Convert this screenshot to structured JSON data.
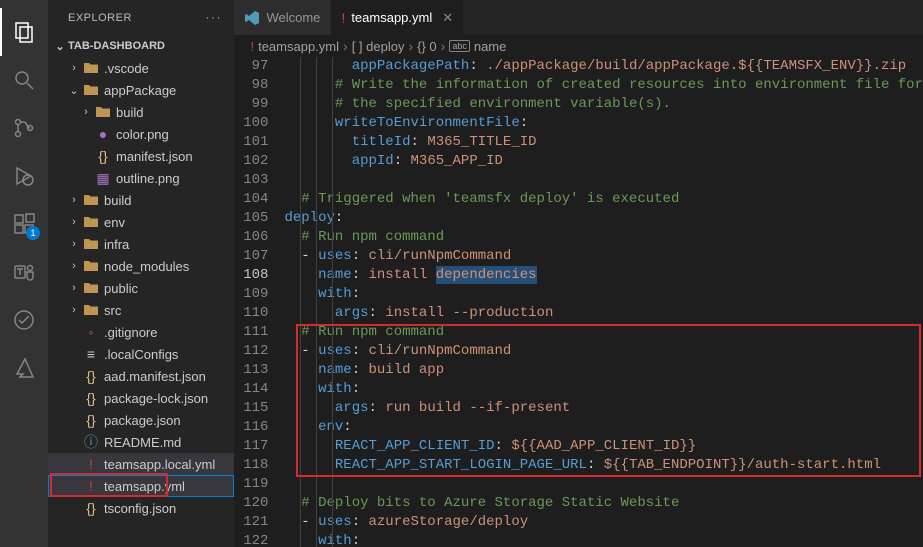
{
  "sidebarTitle": "EXPLORER",
  "sectionTitle": "TAB-DASHBOARD",
  "tree": [
    {
      "indent": 1,
      "chev": "right",
      "iconColor": "",
      "name": ".vscode",
      "folder": true
    },
    {
      "indent": 1,
      "chev": "down",
      "iconColor": "",
      "name": "appPackage",
      "folder": true
    },
    {
      "indent": 2,
      "chev": "right",
      "iconColor": "",
      "name": "build",
      "folder": true
    },
    {
      "indent": 2,
      "chev": "none",
      "iconColor": "ico-purple",
      "icon": "●",
      "name": "color.png"
    },
    {
      "indent": 2,
      "chev": "none",
      "iconColor": "ico-yellow",
      "icon": "{}",
      "name": "manifest.json"
    },
    {
      "indent": 2,
      "chev": "none",
      "iconColor": "ico-purple",
      "icon": "▦",
      "name": "outline.png"
    },
    {
      "indent": 1,
      "chev": "right",
      "iconColor": "",
      "name": "build",
      "folder": true
    },
    {
      "indent": 1,
      "chev": "right",
      "iconColor": "",
      "name": "env",
      "folder": true
    },
    {
      "indent": 1,
      "chev": "right",
      "iconColor": "",
      "name": "infra",
      "folder": true
    },
    {
      "indent": 1,
      "chev": "right",
      "iconColor": "",
      "name": "node_modules",
      "folder": true
    },
    {
      "indent": 1,
      "chev": "right",
      "iconColor": "",
      "name": "public",
      "folder": true
    },
    {
      "indent": 1,
      "chev": "right",
      "iconColor": "",
      "name": "src",
      "folder": true
    },
    {
      "indent": 1,
      "chev": "none",
      "iconColor": "ico-orange",
      "icon": "◦",
      "name": ".gitignore"
    },
    {
      "indent": 1,
      "chev": "none",
      "iconColor": "",
      "icon": "≡",
      "name": ".localConfigs"
    },
    {
      "indent": 1,
      "chev": "none",
      "iconColor": "ico-yellow",
      "icon": "{}",
      "name": "aad.manifest.json"
    },
    {
      "indent": 1,
      "chev": "none",
      "iconColor": "ico-yellow",
      "icon": "{}",
      "name": "package-lock.json"
    },
    {
      "indent": 1,
      "chev": "none",
      "iconColor": "ico-yellow",
      "icon": "{}",
      "name": "package.json"
    },
    {
      "indent": 1,
      "chev": "none",
      "iconColor": "ico-blue",
      "icon": "ⓘ",
      "name": "README.md"
    },
    {
      "indent": 1,
      "chev": "none",
      "iconColor": "ico-red",
      "icon": "!",
      "name": "teamsapp.local.yml",
      "highlighted": true
    },
    {
      "indent": 1,
      "chev": "none",
      "iconColor": "ico-red",
      "icon": "!",
      "name": "teamsapp.yml",
      "selected": true
    },
    {
      "indent": 1,
      "chev": "none",
      "iconColor": "ico-yellow",
      "icon": "{}",
      "name": "tsconfig.json"
    }
  ],
  "tabs": [
    {
      "icon": "vs",
      "label": "Welcome",
      "active": false
    },
    {
      "icon": "!",
      "iconColor": "ico-red",
      "label": "teamsapp.yml",
      "active": true,
      "close": true
    }
  ],
  "breadcrumb": {
    "file": "teamsapp.yml",
    "seg1": "[ ] deploy",
    "seg2": "{} 0",
    "seg3": "name",
    "seg3icon": "abc"
  },
  "code": {
    "startLine": 97,
    "currentLine": 108,
    "lines": [
      [
        {
          "t": "        ",
          "c": ""
        },
        {
          "t": "appPackagePath",
          "c": "c-key"
        },
        {
          "t": ": ",
          "c": ""
        },
        {
          "t": "./appPackage/build/appPackage.${{TEAMSFX_ENV}}.zip",
          "c": "c-str"
        }
      ],
      [
        {
          "t": "      ",
          "c": ""
        },
        {
          "t": "# Write the information of created resources into environment file for",
          "c": "c-comment"
        }
      ],
      [
        {
          "t": "      ",
          "c": ""
        },
        {
          "t": "# the specified environment variable(s).",
          "c": "c-comment"
        }
      ],
      [
        {
          "t": "      ",
          "c": ""
        },
        {
          "t": "writeToEnvironmentFile",
          "c": "c-key"
        },
        {
          "t": ":",
          "c": ""
        }
      ],
      [
        {
          "t": "        ",
          "c": ""
        },
        {
          "t": "titleId",
          "c": "c-key"
        },
        {
          "t": ": ",
          "c": ""
        },
        {
          "t": "M365_TITLE_ID",
          "c": "c-str"
        }
      ],
      [
        {
          "t": "        ",
          "c": ""
        },
        {
          "t": "appId",
          "c": "c-key"
        },
        {
          "t": ": ",
          "c": ""
        },
        {
          "t": "M365_APP_ID",
          "c": "c-str"
        }
      ],
      [],
      [
        {
          "t": "  ",
          "c": ""
        },
        {
          "t": "# Triggered when 'teamsfx deploy' is executed",
          "c": "c-comment"
        }
      ],
      [
        {
          "t": "",
          "c": ""
        },
        {
          "t": "deploy",
          "c": "c-key"
        },
        {
          "t": ":",
          "c": ""
        }
      ],
      [
        {
          "t": "  ",
          "c": ""
        },
        {
          "t": "# Run npm command",
          "c": "c-comment"
        }
      ],
      [
        {
          "t": "  - ",
          "c": ""
        },
        {
          "t": "uses",
          "c": "c-key"
        },
        {
          "t": ": ",
          "c": ""
        },
        {
          "t": "cli/runNpmCommand",
          "c": "c-str"
        }
      ],
      [
        {
          "t": "    ",
          "c": ""
        },
        {
          "t": "name",
          "c": "c-key"
        },
        {
          "t": ": ",
          "c": ""
        },
        {
          "t": "install ",
          "c": "c-str"
        },
        {
          "t": "dependencies",
          "c": "c-str",
          "sel": true
        }
      ],
      [
        {
          "t": "    ",
          "c": ""
        },
        {
          "t": "with",
          "c": "c-key"
        },
        {
          "t": ":",
          "c": ""
        }
      ],
      [
        {
          "t": "      ",
          "c": ""
        },
        {
          "t": "args",
          "c": "c-key"
        },
        {
          "t": ": ",
          "c": ""
        },
        {
          "t": "install --production",
          "c": "c-str"
        }
      ],
      [
        {
          "t": "  ",
          "c": ""
        },
        {
          "t": "# Run npm command",
          "c": "c-comment"
        }
      ],
      [
        {
          "t": "  - ",
          "c": ""
        },
        {
          "t": "uses",
          "c": "c-key"
        },
        {
          "t": ": ",
          "c": ""
        },
        {
          "t": "cli/runNpmCommand",
          "c": "c-str"
        }
      ],
      [
        {
          "t": "    ",
          "c": ""
        },
        {
          "t": "name",
          "c": "c-key"
        },
        {
          "t": ": ",
          "c": ""
        },
        {
          "t": "build app",
          "c": "c-str"
        }
      ],
      [
        {
          "t": "    ",
          "c": ""
        },
        {
          "t": "with",
          "c": "c-key"
        },
        {
          "t": ":",
          "c": ""
        }
      ],
      [
        {
          "t": "      ",
          "c": ""
        },
        {
          "t": "args",
          "c": "c-key"
        },
        {
          "t": ": ",
          "c": ""
        },
        {
          "t": "run build --if-present",
          "c": "c-str"
        }
      ],
      [
        {
          "t": "    ",
          "c": ""
        },
        {
          "t": "env",
          "c": "c-key"
        },
        {
          "t": ":",
          "c": ""
        }
      ],
      [
        {
          "t": "      ",
          "c": ""
        },
        {
          "t": "REACT_APP_CLIENT_ID",
          "c": "c-key"
        },
        {
          "t": ": ",
          "c": ""
        },
        {
          "t": "${{AAD_APP_CLIENT_ID}}",
          "c": "c-str"
        }
      ],
      [
        {
          "t": "      ",
          "c": ""
        },
        {
          "t": "REACT_APP_START_LOGIN_PAGE_URL",
          "c": "c-key"
        },
        {
          "t": ": ",
          "c": ""
        },
        {
          "t": "${{TAB_ENDPOINT}}/auth-start.html",
          "c": "c-str"
        }
      ],
      [],
      [
        {
          "t": "  ",
          "c": ""
        },
        {
          "t": "# Deploy bits to Azure Storage Static Website",
          "c": "c-comment"
        }
      ],
      [
        {
          "t": "  - ",
          "c": ""
        },
        {
          "t": "uses",
          "c": "c-key"
        },
        {
          "t": ": ",
          "c": ""
        },
        {
          "t": "azureStorage/deploy",
          "c": "c-str"
        }
      ],
      [
        {
          "t": "    ",
          "c": ""
        },
        {
          "t": "with",
          "c": "c-key"
        },
        {
          "t": ":",
          "c": ""
        }
      ]
    ],
    "highlightBox": {
      "fromLine": 111,
      "toLine": 118
    }
  },
  "extBadge": "1"
}
